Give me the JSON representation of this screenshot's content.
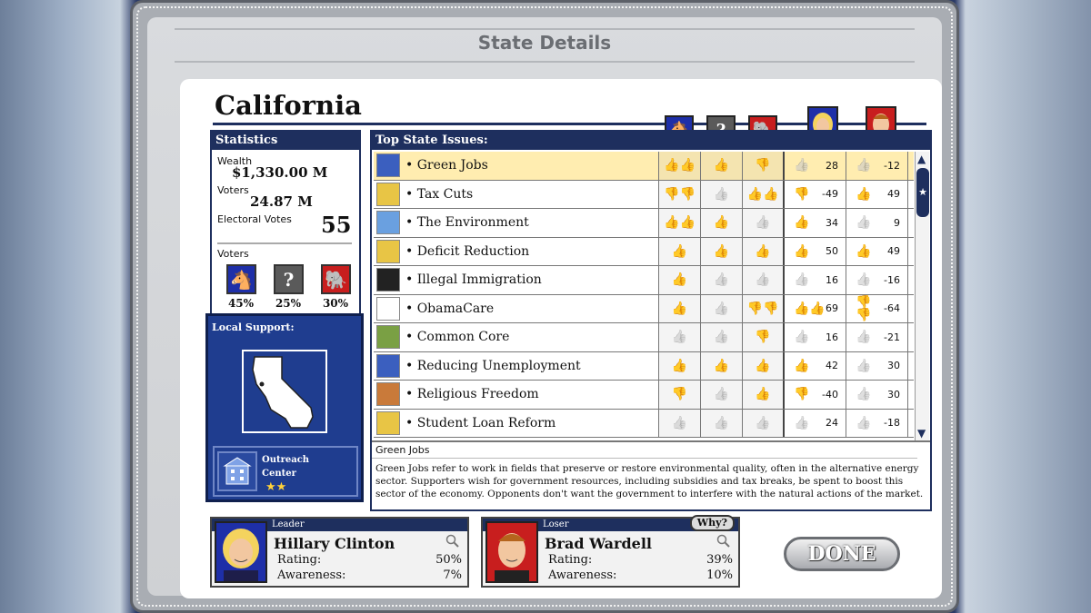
{
  "window": {
    "title": "State Details"
  },
  "state": {
    "name": "California"
  },
  "statistics": {
    "title": "Statistics",
    "wealth_label": "Wealth",
    "wealth_value": "$1,330.00 M",
    "voters_label": "Voters",
    "voters_value": "24.87 M",
    "electoral_label": "Electoral Votes",
    "electoral_value": "55",
    "voters_section_label": "Voters",
    "voter_split": [
      {
        "party": "Democrat",
        "pct": "45%",
        "color": "#1e2fa8",
        "icon": "donkey-icon"
      },
      {
        "party": "Independent",
        "pct": "25%",
        "color": "#5a5a5a",
        "icon": "question-icon"
      },
      {
        "party": "Republican",
        "pct": "30%",
        "color": "#c81e1e",
        "icon": "elephant-icon"
      }
    ]
  },
  "local_support": {
    "title": "Local Support:",
    "outreach_label_1": "Outreach",
    "outreach_label_2": "Center",
    "outreach_stars": "★★"
  },
  "issues": {
    "title": "Top State Issues:",
    "rows": [
      {
        "label": "Green Jobs",
        "dem": "up2",
        "ind": "up",
        "rep": "down",
        "c1_thumb": "neutral",
        "c1_val": "28",
        "c2_thumb": "neutral",
        "c2_val": "-12",
        "selected": true
      },
      {
        "label": "Tax Cuts",
        "dem": "down2",
        "ind": "neutral",
        "rep": "up2",
        "c1_thumb": "down",
        "c1_val": "-49",
        "c2_thumb": "up",
        "c2_val": "49"
      },
      {
        "label": "The Environment",
        "dem": "up2",
        "ind": "up",
        "rep": "neutral",
        "c1_thumb": "up",
        "c1_val": "34",
        "c2_thumb": "neutral",
        "c2_val": "9"
      },
      {
        "label": "Deficit Reduction",
        "dem": "up",
        "ind": "up",
        "rep": "up",
        "c1_thumb": "up",
        "c1_val": "50",
        "c2_thumb": "up",
        "c2_val": "49"
      },
      {
        "label": "Illegal Immigration",
        "dem": "up",
        "ind": "neutral",
        "rep": "neutral",
        "c1_thumb": "neutral",
        "c1_val": "16",
        "c2_thumb": "neutral",
        "c2_val": "-16"
      },
      {
        "label": "ObamaCare",
        "dem": "up",
        "ind": "neutral",
        "rep": "down2",
        "c1_thumb": "up2",
        "c1_val": "69",
        "c2_thumb": "down2",
        "c2_val": "-64"
      },
      {
        "label": "Common Core",
        "dem": "neutral",
        "ind": "neutral",
        "rep": "down",
        "c1_thumb": "neutral",
        "c1_val": "16",
        "c2_thumb": "neutral",
        "c2_val": "-21"
      },
      {
        "label": "Reducing Unemployment",
        "dem": "up",
        "ind": "up",
        "rep": "up",
        "c1_thumb": "up",
        "c1_val": "42",
        "c2_thumb": "neutral",
        "c2_val": "30"
      },
      {
        "label": "Religious Freedom",
        "dem": "down",
        "ind": "neutral",
        "rep": "up",
        "c1_thumb": "down",
        "c1_val": "-40",
        "c2_thumb": "neutral",
        "c2_val": "30"
      },
      {
        "label": "Student Loan Reform",
        "dem": "neutral",
        "ind": "neutral",
        "rep": "neutral",
        "c1_thumb": "neutral",
        "c1_val": "24",
        "c2_thumb": "neutral",
        "c2_val": "-18"
      }
    ],
    "description_title": "Green Jobs",
    "description": "Green Jobs refer to work in fields that preserve or restore environmental quality, often in the alternative energy sector. Supporters wish for government resources, including subsidies and tax breaks, be spent to boost this sector of the economy. Opponents don't want the government to interfere with the natural actions of the market."
  },
  "leader": {
    "role": "Leader",
    "name": "Hillary Clinton",
    "rating_label": "Rating:",
    "rating_value": "50%",
    "awareness_label": "Awareness:",
    "awareness_value": "7%"
  },
  "loser": {
    "role": "Loser",
    "name": "Brad Wardell",
    "rating_label": "Rating:",
    "rating_value": "39%",
    "awareness_label": "Awareness:",
    "awareness_value": "10%",
    "why_label": "Why?"
  },
  "done_label": "DONE",
  "colors": {
    "navy": "#1e2f5e",
    "up": "#2aa82a",
    "down": "#d81f1f",
    "neutral": "#8a8a8a",
    "highlight": "#ffedb0"
  }
}
